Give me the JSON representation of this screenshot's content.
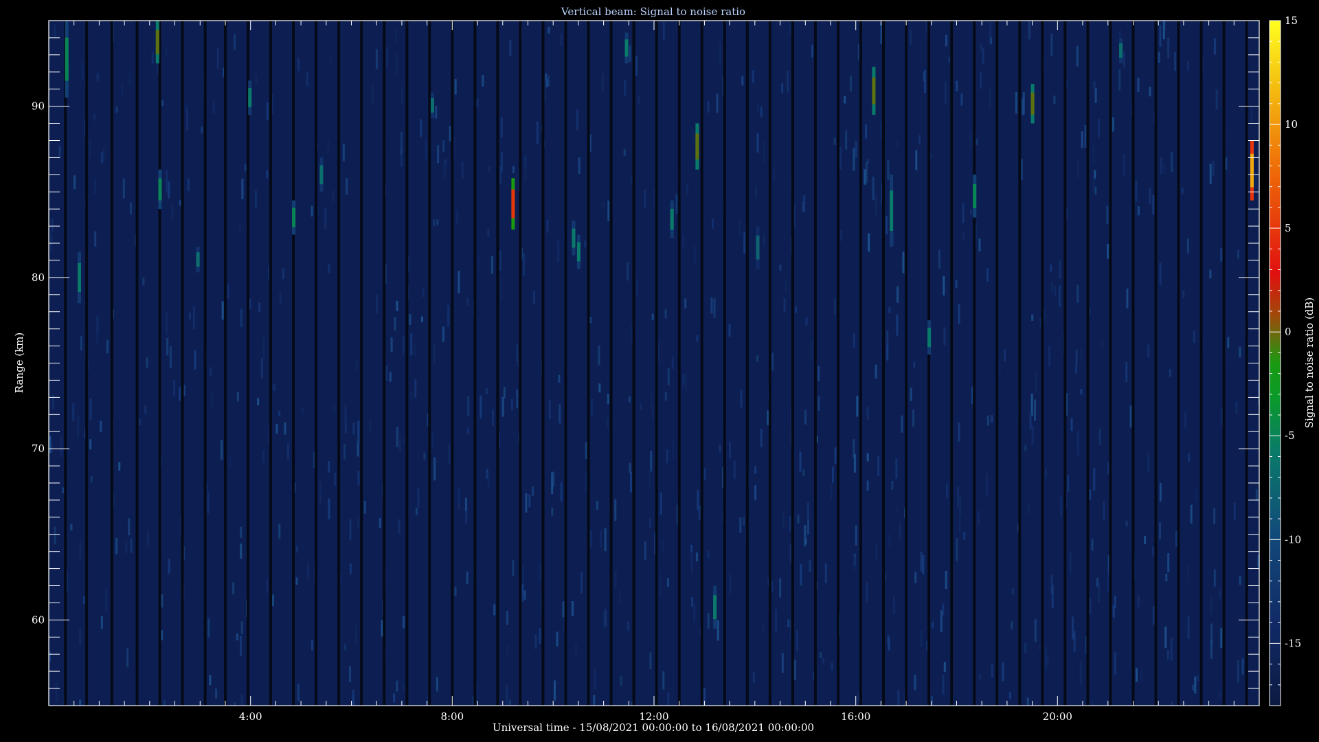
{
  "chart_data": {
    "type": "heatmap",
    "title": "Vertical beam: Signal to noise ratio",
    "xlabel": "Universal time - 15/08/2021 00:00:00 to 16/08/2021 00:00:00",
    "ylabel": "Range (km)",
    "xlim_hours": [
      0,
      24
    ],
    "ylim_km": [
      55,
      95
    ],
    "x_tick_labels": [
      {
        "hour": 4,
        "label": "4:00"
      },
      {
        "hour": 8,
        "label": "8:00"
      },
      {
        "hour": 12,
        "label": "12:00"
      },
      {
        "hour": 16,
        "label": "16:00"
      },
      {
        "hour": 20,
        "label": "20:00"
      }
    ],
    "y_tick_labels": [
      {
        "km": 60,
        "label": "60"
      },
      {
        "km": 70,
        "label": "70"
      },
      {
        "km": 80,
        "label": "80"
      },
      {
        "km": 90,
        "label": "90"
      }
    ],
    "colorbar": {
      "label": "Signal to noise ratio (dB)",
      "range": [
        -18,
        15
      ],
      "ticks": [
        {
          "value": 15,
          "label": "15"
        },
        {
          "value": 10,
          "label": "10"
        },
        {
          "value": 5,
          "label": "5"
        },
        {
          "value": 0,
          "label": "0"
        },
        {
          "value": -5,
          "label": "-5"
        },
        {
          "value": -10,
          "label": "-10"
        },
        {
          "value": -15,
          "label": "-15"
        }
      ]
    },
    "background_snr_db": -16,
    "data_gap_times_hours": [
      0.33,
      0.75,
      1.25,
      1.75,
      2.2,
      2.65,
      3.1,
      3.5,
      3.95,
      4.4,
      4.85,
      5.3,
      5.75,
      6.2,
      6.65,
      7.1,
      7.55,
      8.0,
      8.45,
      8.9,
      9.35,
      9.8,
      10.25,
      10.7,
      11.15,
      11.6,
      12.05,
      12.5,
      12.95,
      13.4,
      13.85,
      14.3,
      14.75,
      15.2,
      15.65,
      16.1,
      16.55,
      17.0,
      17.45,
      17.9,
      18.35,
      18.8,
      19.25,
      19.7,
      20.15,
      20.6,
      21.05,
      21.5,
      21.95,
      22.4,
      22.85,
      23.3,
      23.75
    ],
    "echoes": [
      {
        "time_h": 0.35,
        "range_top_km": 95.0,
        "range_bottom_km": 90.5,
        "snr_db": -5
      },
      {
        "time_h": 0.6,
        "range_top_km": 81.5,
        "range_bottom_km": 78.5,
        "snr_db": -6
      },
      {
        "time_h": 2.15,
        "range_top_km": 95.0,
        "range_bottom_km": 92.5,
        "snr_db": 0
      },
      {
        "time_h": 2.2,
        "range_top_km": 86.3,
        "range_bottom_km": 84.0,
        "snr_db": -5
      },
      {
        "time_h": 2.95,
        "range_top_km": 81.8,
        "range_bottom_km": 80.3,
        "snr_db": -7
      },
      {
        "time_h": 3.98,
        "range_top_km": 91.5,
        "range_bottom_km": 89.5,
        "snr_db": -6
      },
      {
        "time_h": 4.85,
        "range_top_km": 84.5,
        "range_bottom_km": 82.5,
        "snr_db": -5
      },
      {
        "time_h": 5.4,
        "range_top_km": 87.0,
        "range_bottom_km": 85.0,
        "snr_db": -7
      },
      {
        "time_h": 7.6,
        "range_top_km": 90.8,
        "range_bottom_km": 89.3,
        "snr_db": -7
      },
      {
        "time_h": 9.2,
        "range_top_km": 85.8,
        "range_bottom_km": 82.8,
        "snr_db": 5
      },
      {
        "time_h": 10.4,
        "range_top_km": 83.3,
        "range_bottom_km": 81.3,
        "snr_db": -6
      },
      {
        "time_h": 10.5,
        "range_top_km": 82.5,
        "range_bottom_km": 80.5,
        "snr_db": -6
      },
      {
        "time_h": 11.45,
        "range_top_km": 94.3,
        "range_bottom_km": 92.5,
        "snr_db": -6
      },
      {
        "time_h": 12.35,
        "range_top_km": 84.5,
        "range_bottom_km": 82.3,
        "snr_db": -6
      },
      {
        "time_h": 12.85,
        "range_top_km": 89.0,
        "range_bottom_km": 86.3,
        "snr_db": 0
      },
      {
        "time_h": 13.2,
        "range_top_km": 62.0,
        "range_bottom_km": 59.5,
        "snr_db": -6
      },
      {
        "time_h": 14.05,
        "range_top_km": 83.0,
        "range_bottom_km": 80.5,
        "snr_db": -8
      },
      {
        "time_h": 16.35,
        "range_top_km": 92.3,
        "range_bottom_km": 89.5,
        "snr_db": 0
      },
      {
        "time_h": 16.7,
        "range_top_km": 86.0,
        "range_bottom_km": 81.8,
        "snr_db": -6
      },
      {
        "time_h": 17.45,
        "range_top_km": 77.5,
        "range_bottom_km": 75.5,
        "snr_db": -6
      },
      {
        "time_h": 18.35,
        "range_top_km": 86.0,
        "range_bottom_km": 83.5,
        "snr_db": -5
      },
      {
        "time_h": 19.5,
        "range_top_km": 91.3,
        "range_bottom_km": 89.0,
        "snr_db": 0
      },
      {
        "time_h": 21.25,
        "range_top_km": 94.0,
        "range_bottom_km": 92.5,
        "snr_db": -7
      },
      {
        "time_h": 23.85,
        "range_top_km": 88.0,
        "range_bottom_km": 84.5,
        "snr_db": 11
      }
    ]
  }
}
